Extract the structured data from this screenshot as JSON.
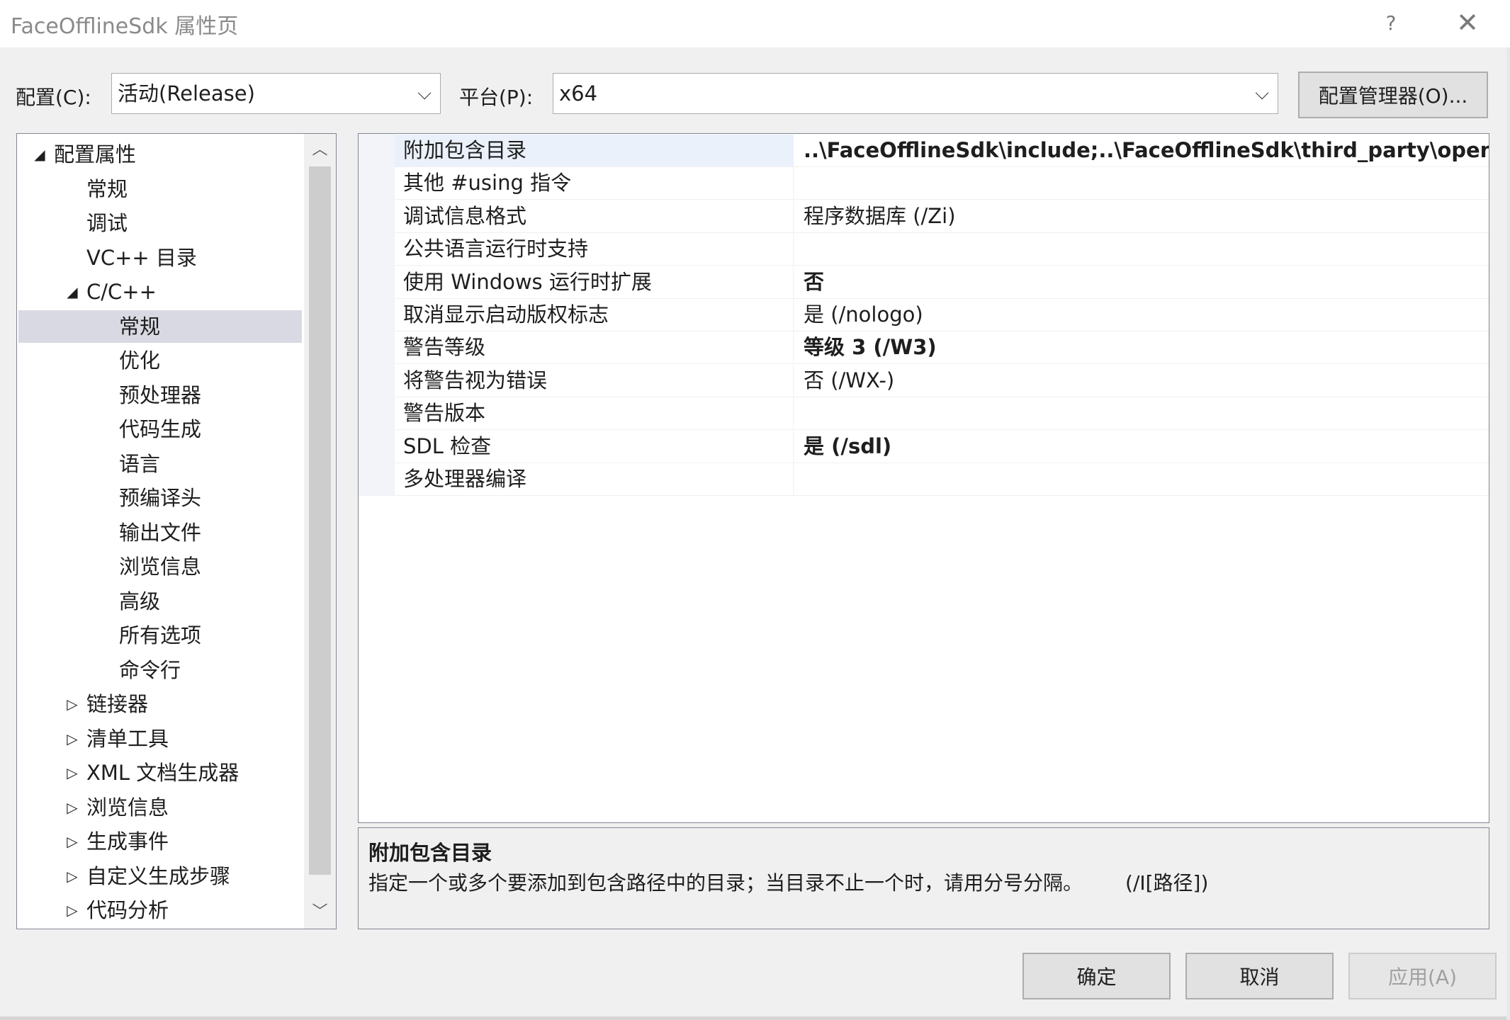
{
  "window": {
    "title": "FaceOfflineSdk 属性页",
    "help": "?",
    "close": "✕"
  },
  "config": {
    "label": "配置(C):",
    "value": "活动(Release)"
  },
  "platform": {
    "label": "平台(P):",
    "value": "x64"
  },
  "config_manager_button": "配置管理器(O)...",
  "tree": {
    "items": [
      {
        "label": "配置属性",
        "toggle": "◢",
        "level": 0
      },
      {
        "label": "常规",
        "toggle": "",
        "level": 1
      },
      {
        "label": "调试",
        "toggle": "",
        "level": 1
      },
      {
        "label": "VC++ 目录",
        "toggle": "",
        "level": 1
      },
      {
        "label": "C/C++",
        "toggle": "◢",
        "level": 1
      },
      {
        "label": "常规",
        "toggle": "",
        "level": 2,
        "selected": true
      },
      {
        "label": "优化",
        "toggle": "",
        "level": 2
      },
      {
        "label": "预处理器",
        "toggle": "",
        "level": 2
      },
      {
        "label": "代码生成",
        "toggle": "",
        "level": 2
      },
      {
        "label": "语言",
        "toggle": "",
        "level": 2
      },
      {
        "label": "预编译头",
        "toggle": "",
        "level": 2
      },
      {
        "label": "输出文件",
        "toggle": "",
        "level": 2
      },
      {
        "label": "浏览信息",
        "toggle": "",
        "level": 2
      },
      {
        "label": "高级",
        "toggle": "",
        "level": 2
      },
      {
        "label": "所有选项",
        "toggle": "",
        "level": 2
      },
      {
        "label": "命令行",
        "toggle": "",
        "level": 2
      },
      {
        "label": "链接器",
        "toggle": "▷",
        "level": 1
      },
      {
        "label": "清单工具",
        "toggle": "▷",
        "level": 1
      },
      {
        "label": "XML 文档生成器",
        "toggle": "▷",
        "level": 1
      },
      {
        "label": "浏览信息",
        "toggle": "▷",
        "level": 1
      },
      {
        "label": "生成事件",
        "toggle": "▷",
        "level": 1
      },
      {
        "label": "自定义生成步骤",
        "toggle": "▷",
        "level": 1
      },
      {
        "label": "代码分析",
        "toggle": "▷",
        "level": 1
      }
    ],
    "scroll_up": "︿",
    "scroll_down": "﹀"
  },
  "properties": [
    {
      "name": "附加包含目录",
      "value": "..\\FaceOfflineSdk\\include;..\\FaceOfflineSdk\\third_party\\openc",
      "bold": true,
      "selected": true
    },
    {
      "name": "其他 #using 指令",
      "value": "",
      "bold": false
    },
    {
      "name": "调试信息格式",
      "value": "程序数据库 (/Zi)",
      "bold": false
    },
    {
      "name": "公共语言运行时支持",
      "value": "",
      "bold": false
    },
    {
      "name": "使用 Windows 运行时扩展",
      "value": "否",
      "bold": true
    },
    {
      "name": "取消显示启动版权标志",
      "value": "是 (/nologo)",
      "bold": false
    },
    {
      "name": "警告等级",
      "value": "等级 3 (/W3)",
      "bold": true
    },
    {
      "name": "将警告视为错误",
      "value": "否 (/WX-)",
      "bold": false
    },
    {
      "name": "警告版本",
      "value": "",
      "bold": false
    },
    {
      "name": "SDL 检查",
      "value": "是 (/sdl)",
      "bold": true
    },
    {
      "name": "多处理器编译",
      "value": "",
      "bold": false
    }
  ],
  "description": {
    "title": "附加包含目录",
    "text": "指定一个或多个要添加到包含路径中的目录；当目录不止一个时，请用分号分隔。",
    "switch": "(/I[路径])"
  },
  "buttons": {
    "ok": "确定",
    "cancel": "取消",
    "apply": "应用(A)"
  }
}
